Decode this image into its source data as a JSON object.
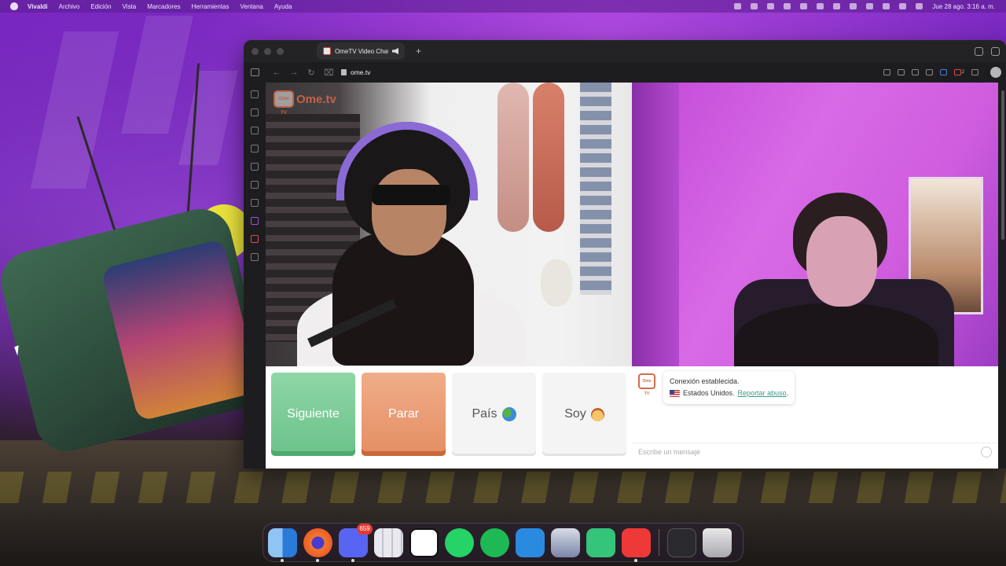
{
  "menubar": {
    "app_name": "Vivaldi",
    "menus": [
      "Archivo",
      "Edición",
      "Vista",
      "Marcadores",
      "Herramientas",
      "Ventana",
      "Ayuda"
    ],
    "clock": "Jue 28 ago. 3:16 a. m."
  },
  "browser": {
    "tab_title": "OmeTV Video Chat – ",
    "url": "ome.tv",
    "notification_count": "2"
  },
  "page": {
    "logo_badge": "Ome TV",
    "logo_text": "Ome.tv",
    "buttons": {
      "next": "Siguiente",
      "stop": "Parar",
      "country": "País",
      "soy": "Soy"
    },
    "chat": {
      "avatar_label": "Ome TV",
      "status": "Conexión establecida.",
      "country": "Estados Unidos.",
      "report": "Reportar abuso",
      "report_suffix": ".",
      "input_placeholder": "Escribe un mensaje"
    }
  },
  "dock": {
    "apps": [
      "Finder",
      "Firefox",
      "Discord",
      "Launchpad",
      "Notion",
      "WhatsApp",
      "Spotify",
      "Visual Studio Code",
      "Preview",
      "Kick",
      "Vivaldi",
      "Streaming App",
      "Trash"
    ],
    "discord_badge": "659"
  },
  "colors": {
    "next_button": "#6bc28a",
    "stop_button": "#e48e63",
    "brand_accent": "#d86a4a",
    "report_link": "#3a9a8a"
  }
}
